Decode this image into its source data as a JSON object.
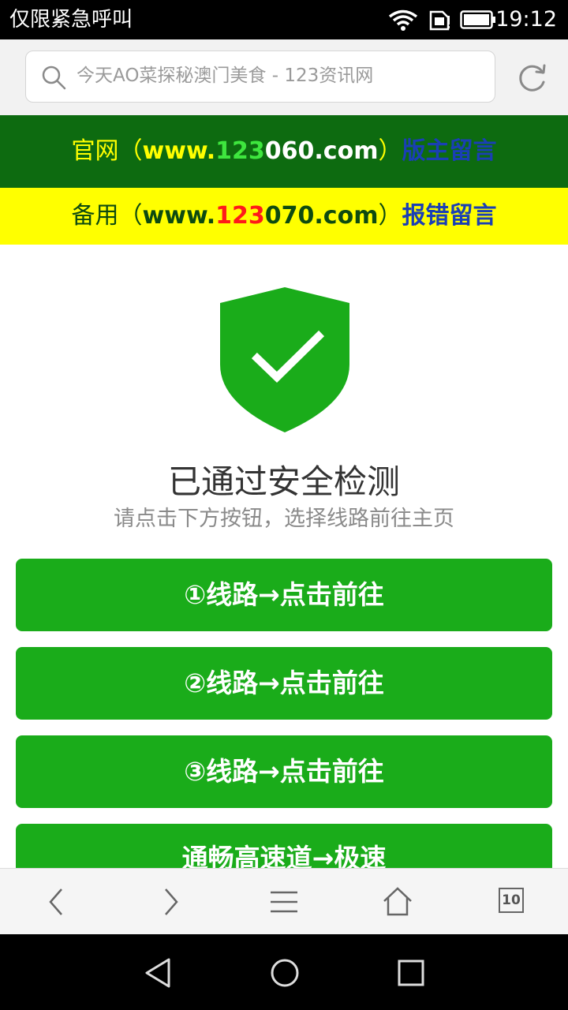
{
  "status_bar": {
    "carrier": "仅限紧急呼叫",
    "time": "19:12",
    "icons": [
      "wifi-icon",
      "sim-icon",
      "battery-icon"
    ]
  },
  "address_bar": {
    "url_text": "今天AO菜探秘澳门美食 - 123资讯网",
    "icons": [
      "search-icon",
      "reload-icon"
    ]
  },
  "banners": {
    "official": {
      "prefix": "官网（",
      "url_www": "www.",
      "url_num": "123",
      "url_rest": "060.com",
      "suffix": "）",
      "link": "版主留言"
    },
    "backup": {
      "prefix": "备用（",
      "url_www": "www.",
      "url_num": "123",
      "url_rest": "070.com",
      "suffix": "）",
      "link": "报错留言"
    }
  },
  "security": {
    "headline": "已通过安全检测",
    "subline": "请点击下方按钮，选择线路前往主页",
    "icon": "shield-check-icon"
  },
  "buttons": [
    {
      "label": "①线路→点击前往"
    },
    {
      "label": "②线路→点击前往"
    },
    {
      "label": "③线路→点击前往"
    },
    {
      "label": "通畅高速道→极速"
    }
  ],
  "toolbar": {
    "tabs_count": "10",
    "icons": [
      "back-icon",
      "forward-icon",
      "menu-icon",
      "home-icon",
      "tabs-icon"
    ]
  },
  "nav_bar": {
    "icons": [
      "nav-back-icon",
      "nav-home-icon",
      "nav-recents-icon"
    ]
  },
  "colors": {
    "primary_green": "#1aac1a",
    "banner_dark_green": "#0d6b10",
    "banner_yellow": "#ffff00",
    "link_blue": "#1a3fb5",
    "number_red": "#ff1a1a"
  }
}
